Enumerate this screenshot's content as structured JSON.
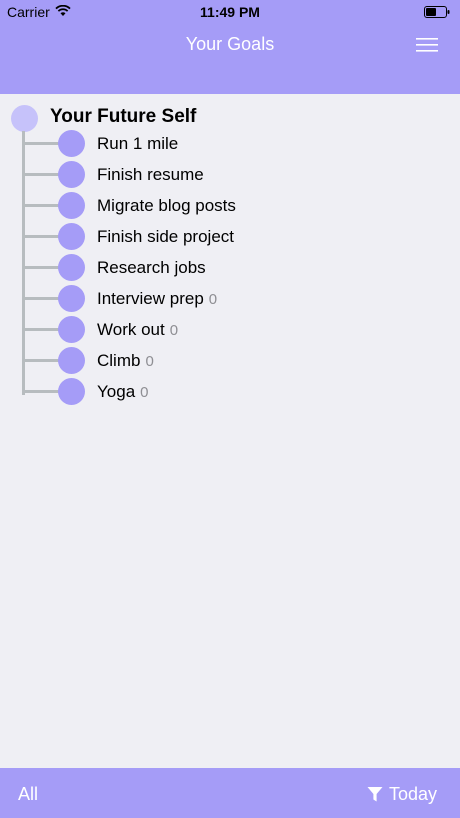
{
  "status_bar": {
    "carrier": "Carrier",
    "time": "11:49 PM"
  },
  "nav": {
    "title": "Your Goals"
  },
  "tree": {
    "root": "Your Future Self",
    "goals": [
      {
        "label": "Run 1 mile",
        "count": ""
      },
      {
        "label": "Finish resume",
        "count": ""
      },
      {
        "label": "Migrate blog posts",
        "count": ""
      },
      {
        "label": "Finish side project",
        "count": ""
      },
      {
        "label": "Research jobs",
        "count": ""
      },
      {
        "label": "Interview prep",
        "count": "0"
      },
      {
        "label": "Work out",
        "count": "0"
      },
      {
        "label": "Climb",
        "count": "0"
      },
      {
        "label": "Yoga",
        "count": "0"
      }
    ]
  },
  "bottom": {
    "all_label": "All",
    "today_label": "Today"
  },
  "colors": {
    "accent": "#a59cf7",
    "root_node": "#c6c2fa",
    "background": "#efeff4",
    "connector": "#b7bcbf"
  }
}
